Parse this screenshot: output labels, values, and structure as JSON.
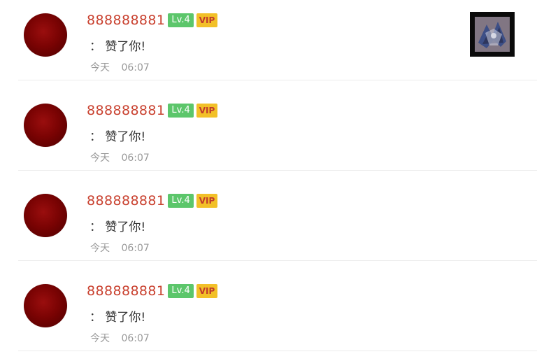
{
  "notifications": [
    {
      "username": "888888881",
      "level": "Lv.4",
      "vip": "VIP",
      "message": "： 赞了你!",
      "date": "今天",
      "time": "06:07",
      "has_thumbnail": true
    },
    {
      "username": "888888881",
      "level": "Lv.4",
      "vip": "VIP",
      "message": "： 赞了你!",
      "date": "今天",
      "time": "06:07",
      "has_thumbnail": false
    },
    {
      "username": "888888881",
      "level": "Lv.4",
      "vip": "VIP",
      "message": "： 赞了你!",
      "date": "今天",
      "time": "06:07",
      "has_thumbnail": false
    },
    {
      "username": "888888881",
      "level": "Lv.4",
      "vip": "VIP",
      "message": "： 赞了你!",
      "date": "今天",
      "time": "06:07",
      "has_thumbnail": false
    }
  ],
  "colors": {
    "username": "#c9412f",
    "level_badge": "#5cc66b",
    "vip_badge": "#f2c028",
    "vip_text": "#c0392b",
    "avatar": "#7a0303",
    "meta_text": "#999999"
  }
}
